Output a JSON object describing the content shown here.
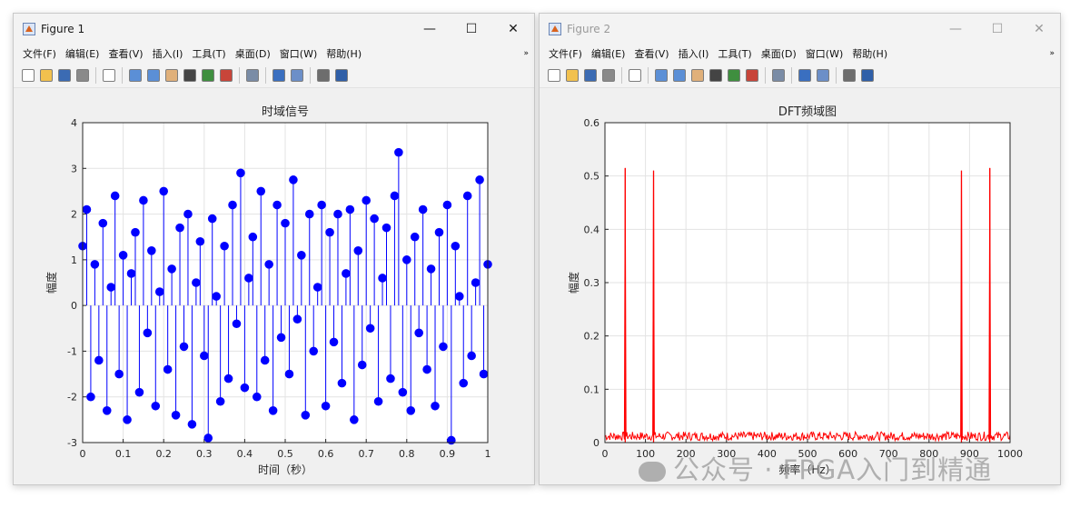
{
  "windows": [
    {
      "title": "Figure 1",
      "controls": {
        "minimize": "—",
        "maximize": "☐",
        "close": "✕"
      },
      "menu": [
        "文件(F)",
        "编辑(E)",
        "查看(V)",
        "插入(I)",
        "工具(T)",
        "桌面(D)",
        "窗口(W)",
        "帮助(H)"
      ],
      "menu_more": "»"
    },
    {
      "title": "Figure 2",
      "controls": {
        "minimize": "—",
        "maximize": "☐",
        "close": "✕"
      },
      "menu": [
        "文件(F)",
        "编辑(E)",
        "查看(V)",
        "插入(I)",
        "工具(T)",
        "桌面(D)",
        "窗口(W)",
        "帮助(H)"
      ],
      "menu_more": "»"
    }
  ],
  "toolbar_icons": [
    "new-figure-icon",
    "open-icon",
    "save-icon",
    "print-icon",
    "separator",
    "pointer-icon",
    "separator",
    "zoom-in-icon",
    "zoom-out-icon",
    "pan-icon",
    "rotate-icon",
    "data-cursor-icon",
    "brush-icon",
    "separator",
    "link-icon",
    "separator",
    "colorbar-icon",
    "legend-icon",
    "separator",
    "hide-tools-icon",
    "dock-icon"
  ],
  "chart_data": [
    {
      "type": "scatter",
      "style": "stem",
      "title": "时域信号",
      "xlabel": "时间（秒）",
      "ylabel": "幅度",
      "xlim": [
        0,
        1
      ],
      "ylim": [
        -3,
        4
      ],
      "xticks": [
        "0",
        "0.1",
        "0.2",
        "0.3",
        "0.4",
        "0.5",
        "0.6",
        "0.7",
        "0.8",
        "0.9",
        "1"
      ],
      "yticks": [
        "-3",
        "-2",
        "-1",
        "0",
        "1",
        "2",
        "3",
        "4"
      ],
      "grid": true,
      "color": "#0000ff",
      "x": [
        0.0,
        0.01,
        0.02,
        0.03,
        0.04,
        0.05,
        0.06,
        0.07,
        0.08,
        0.09,
        0.1,
        0.11,
        0.12,
        0.13,
        0.14,
        0.15,
        0.16,
        0.17,
        0.18,
        0.19,
        0.2,
        0.21,
        0.22,
        0.23,
        0.24,
        0.25,
        0.26,
        0.27,
        0.28,
        0.29,
        0.3,
        0.31,
        0.32,
        0.33,
        0.34,
        0.35,
        0.36,
        0.37,
        0.38,
        0.39,
        0.4,
        0.41,
        0.42,
        0.43,
        0.44,
        0.45,
        0.46,
        0.47,
        0.48,
        0.49,
        0.5,
        0.51,
        0.52,
        0.53,
        0.54,
        0.55,
        0.56,
        0.57,
        0.58,
        0.59,
        0.6,
        0.61,
        0.62,
        0.63,
        0.64,
        0.65,
        0.66,
        0.67,
        0.68,
        0.69,
        0.7,
        0.71,
        0.72,
        0.73,
        0.74,
        0.75,
        0.76,
        0.77,
        0.78,
        0.79,
        0.8,
        0.81,
        0.82,
        0.83,
        0.84,
        0.85,
        0.86,
        0.87,
        0.88,
        0.89,
        0.9,
        0.91,
        0.92,
        0.93,
        0.94,
        0.95,
        0.96,
        0.97,
        0.98,
        0.99,
        1.0
      ],
      "y": [
        1.3,
        2.1,
        -2.0,
        0.9,
        -1.2,
        1.8,
        -2.3,
        0.4,
        2.4,
        -1.5,
        1.1,
        -2.5,
        0.7,
        1.6,
        -1.9,
        2.3,
        -0.6,
        1.2,
        -2.2,
        0.3,
        2.5,
        -1.4,
        0.8,
        -2.4,
        1.7,
        -0.9,
        2.0,
        -2.6,
        0.5,
        1.4,
        -1.1,
        -2.9,
        1.9,
        0.2,
        -2.1,
        1.3,
        -1.6,
        2.2,
        -0.4,
        2.9,
        -1.8,
        0.6,
        1.5,
        -2.0,
        2.5,
        -1.2,
        0.9,
        -2.3,
        2.2,
        -0.7,
        1.8,
        -1.5,
        2.75,
        -0.3,
        1.1,
        -2.4,
        2.0,
        -1.0,
        0.4,
        2.2,
        -2.2,
        1.6,
        -0.8,
        2.0,
        -1.7,
        0.7,
        2.1,
        -2.5,
        1.2,
        -1.3,
        2.3,
        -0.5,
        1.9,
        -2.1,
        0.6,
        1.7,
        -1.6,
        2.4,
        3.35,
        -1.9,
        1.0,
        -2.3,
        1.5,
        -0.6,
        2.1,
        -1.4,
        0.8,
        -2.2,
        1.6,
        -0.9,
        2.2,
        -2.95,
        1.3,
        0.2,
        -1.7,
        2.4,
        -1.1,
        0.5,
        2.75,
        -1.5,
        0.9
      ]
    },
    {
      "type": "line",
      "title": "DFT频域图",
      "xlabel": "频率（Hz）",
      "ylabel": "幅度",
      "xlim": [
        0,
        1000
      ],
      "ylim": [
        0,
        0.6
      ],
      "xticks": [
        "0",
        "100",
        "200",
        "300",
        "400",
        "500",
        "600",
        "700",
        "800",
        "900",
        "1000"
      ],
      "yticks": [
        "0",
        "0.1",
        "0.2",
        "0.3",
        "0.4",
        "0.5",
        "0.6"
      ],
      "grid": true,
      "color": "#ff0000",
      "peaks": [
        {
          "x": 50,
          "y": 0.515
        },
        {
          "x": 120,
          "y": 0.51
        },
        {
          "x": 880,
          "y": 0.51
        },
        {
          "x": 950,
          "y": 0.515
        }
      ],
      "noise_floor": 0.015
    }
  ],
  "watermark": "公众号 · FPGA入门到精通"
}
